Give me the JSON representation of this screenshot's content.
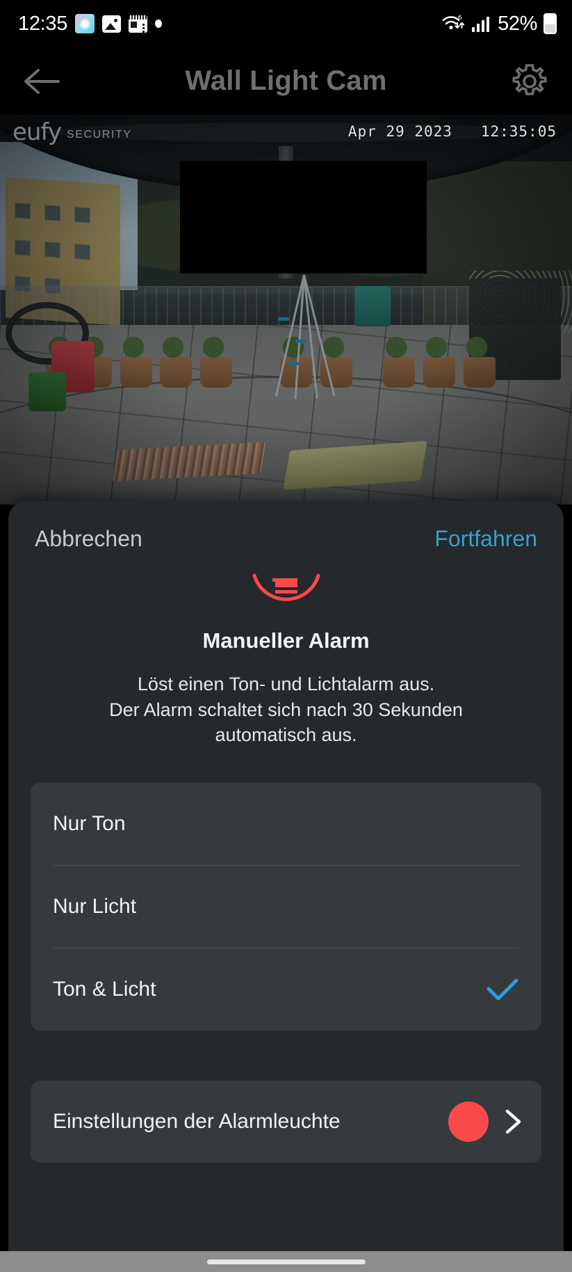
{
  "status_bar": {
    "clock": "12:35",
    "battery_percent": "52%",
    "icons": [
      "gallery-app-icon",
      "photo-icon",
      "news-icon",
      "dot-badge-icon",
      "wifi-icon",
      "cellular-signal-icon",
      "battery-icon"
    ]
  },
  "app_bar": {
    "title": "Wall Light Cam",
    "back_icon": "back-arrow-icon",
    "settings_icon": "gear-icon"
  },
  "camera": {
    "watermark_brand": "eufy",
    "watermark_sub": "SECURITY",
    "timestamp": "Apr 29 2023   12:35:05"
  },
  "sheet": {
    "cancel_label": "Abbrechen",
    "continue_label": "Fortfahren",
    "alarm_icon": "alarm-siren-icon",
    "title": "Manueller Alarm",
    "description": "Löst einen Ton- und Lichtalarm aus.\nDer Alarm schaltet sich nach 30 Sekunden automatisch aus.",
    "options": [
      {
        "label": "Nur Ton",
        "selected": false
      },
      {
        "label": "Nur Licht",
        "selected": false
      },
      {
        "label": "Ton & Licht",
        "selected": true
      }
    ],
    "settings": {
      "label": "Einstellungen der Alarmleuchte",
      "color_value": "#f9494b",
      "chevron_icon": "chevron-right-icon"
    }
  },
  "colors": {
    "accent_blue": "#3a9fd0",
    "alarm_red": "#f9494b",
    "sheet_bg": "#25292c",
    "card_bg": "#353a3d",
    "title_gray": "#6f6f6f"
  }
}
